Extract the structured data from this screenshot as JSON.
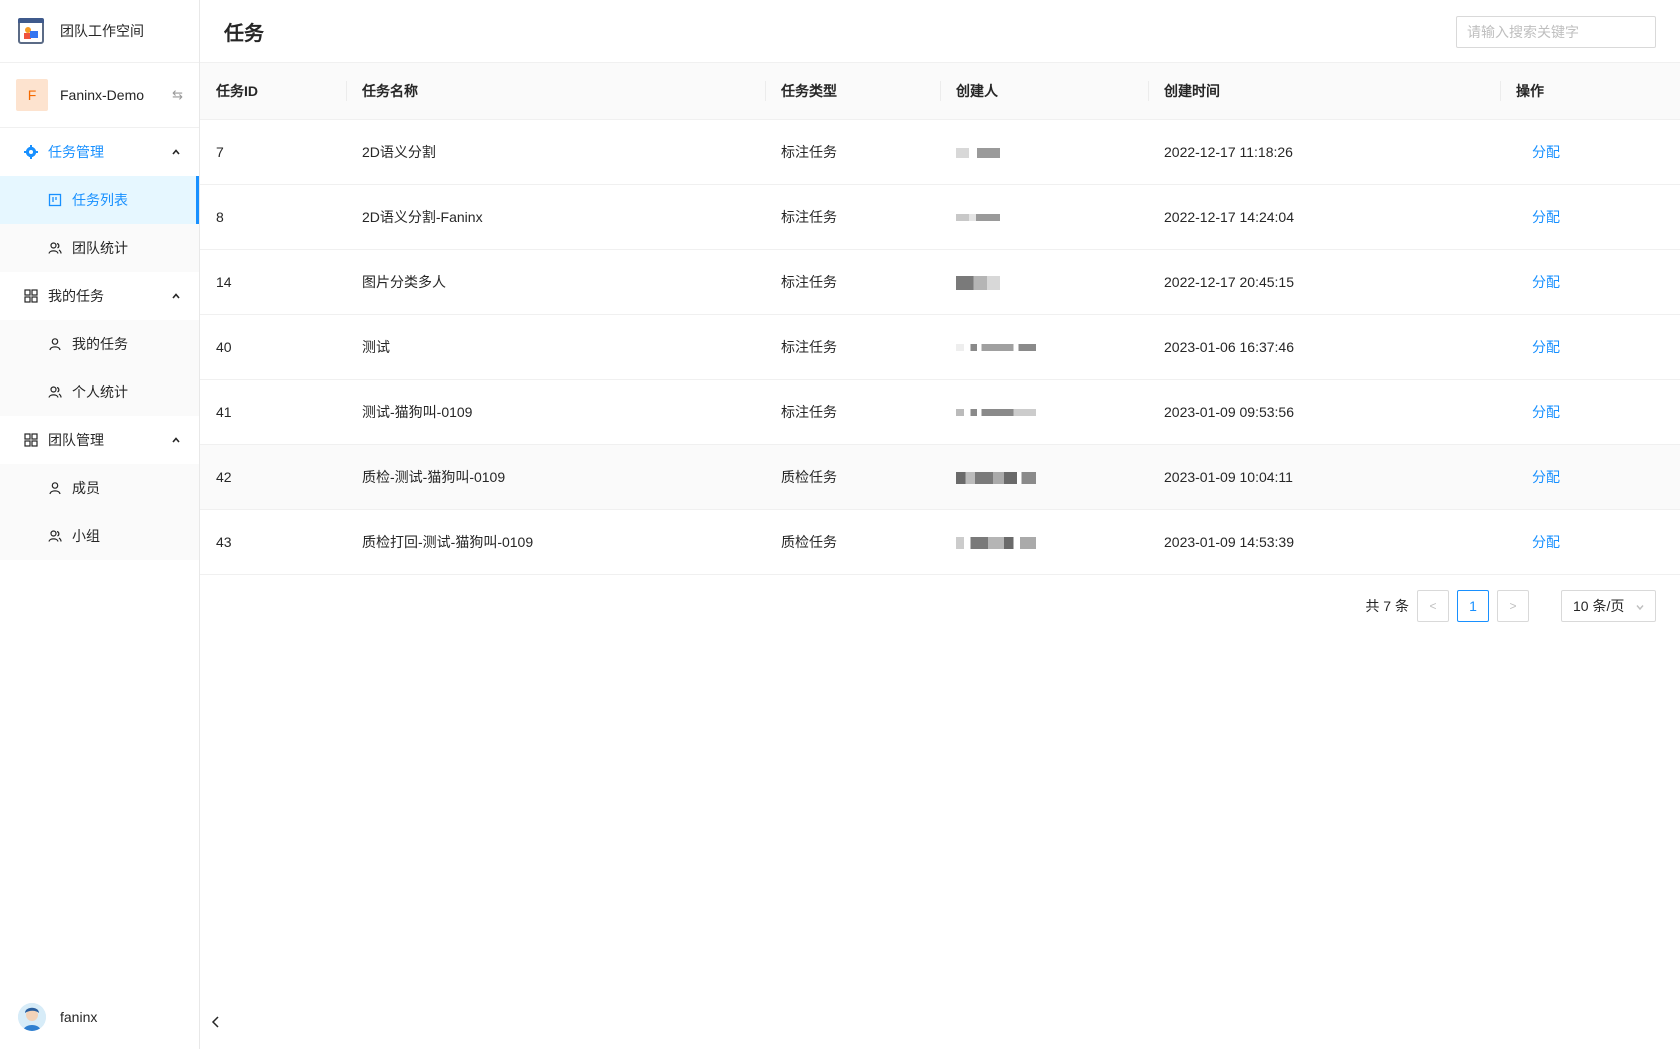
{
  "brand": {
    "title": "团队工作空间"
  },
  "team": {
    "avatar_letter": "F",
    "name": "Faninx-Demo",
    "switch_glyph": "⇆"
  },
  "menu": {
    "task_mgmt": {
      "label": "任务管理",
      "items": [
        {
          "label": "任务列表"
        },
        {
          "label": "团队统计"
        }
      ]
    },
    "my_tasks": {
      "label": "我的任务",
      "items": [
        {
          "label": "我的任务"
        },
        {
          "label": "个人统计"
        }
      ]
    },
    "team_mgmt": {
      "label": "团队管理",
      "items": [
        {
          "label": "成员"
        },
        {
          "label": "小组"
        }
      ]
    }
  },
  "user": {
    "name": "faninx"
  },
  "header": {
    "title": "任务",
    "search_placeholder": "请输入搜索关键字"
  },
  "table": {
    "columns": [
      "任务ID",
      "任务名称",
      "任务类型",
      "创建人",
      "创建时间",
      "操作"
    ],
    "rows": [
      {
        "id": "7",
        "name": "2D语义分割",
        "type": "标注任务",
        "time": "2022-12-17 11:18:26",
        "action": "分配"
      },
      {
        "id": "8",
        "name": "2D语义分割-Faninx",
        "type": "标注任务",
        "time": "2022-12-17 14:24:04",
        "action": "分配"
      },
      {
        "id": "14",
        "name": "图片分类多人",
        "type": "标注任务",
        "time": "2022-12-17 20:45:15",
        "action": "分配"
      },
      {
        "id": "40",
        "name": "测试",
        "type": "标注任务",
        "time": "2023-01-06 16:37:46",
        "action": "分配"
      },
      {
        "id": "41",
        "name": "测试-猫狗叫-0109",
        "type": "标注任务",
        "time": "2023-01-09 09:53:56",
        "action": "分配"
      },
      {
        "id": "42",
        "name": "质检-测试-猫狗叫-0109",
        "type": "质检任务",
        "time": "2023-01-09 10:04:11",
        "action": "分配"
      },
      {
        "id": "43",
        "name": "质检打回-测试-猫狗叫-0109",
        "type": "质检任务",
        "time": "2023-01-09 14:53:39",
        "action": "分配"
      }
    ]
  },
  "pagination": {
    "total_text": "共 7 条",
    "prev": "<",
    "current": "1",
    "next": ">",
    "page_size": "10 条/页"
  },
  "colors": {
    "accent": "#1890ff",
    "team_avatar_bg": "#fde3cf",
    "team_avatar_fg": "#f56a00"
  }
}
